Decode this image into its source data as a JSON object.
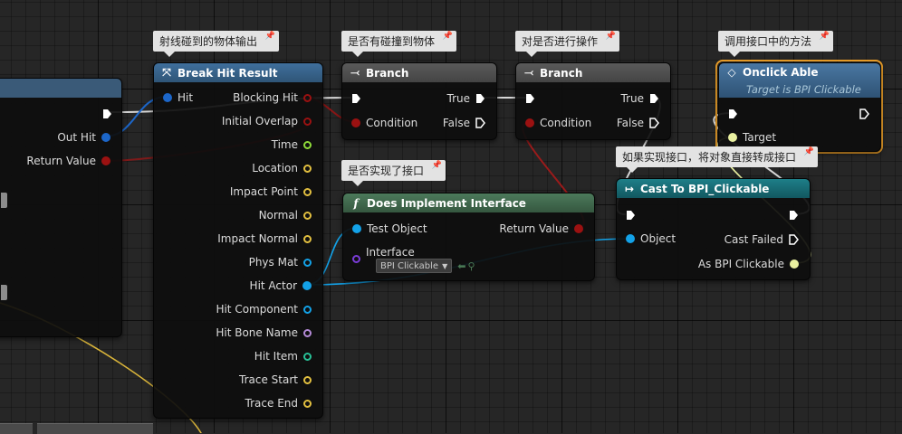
{
  "colors": {
    "exec": "#ffffff",
    "struct": "#1c66c9",
    "float_red": "#c42f2f",
    "bool_red": "#9b1111",
    "vector": "#e3c040",
    "object": "#13a2e8",
    "class": "#7a3cd8",
    "name": "#b58bd8",
    "int": "#28c197",
    "float": "#8fdc3a",
    "interface": "#e9f0a0",
    "hdr_function": "#3a6a95",
    "hdr_branch": "#505050",
    "hdr_cast": "#176b73",
    "hdr_pure": "#3f6b4d",
    "hdr_event": "#3d6388",
    "selection": "#f0a22a"
  },
  "left_node": {
    "pins": [
      {
        "label": "Out Hit",
        "type": "struct"
      },
      {
        "label": "Return Value",
        "type": "bool_red"
      }
    ]
  },
  "break_hit": {
    "title": "Break Hit Result",
    "icon": "break-struct-icon",
    "input": "Hit",
    "outputs": [
      {
        "label": "Blocking Hit",
        "type": "bool_red",
        "filled": false
      },
      {
        "label": "Initial Overlap",
        "type": "bool_red",
        "filled": false
      },
      {
        "label": "Time",
        "type": "float",
        "filled": false
      },
      {
        "label": "Location",
        "type": "vector",
        "filled": false
      },
      {
        "label": "Impact Point",
        "type": "vector",
        "filled": false
      },
      {
        "label": "Normal",
        "type": "vector",
        "filled": false
      },
      {
        "label": "Impact Normal",
        "type": "vector",
        "filled": false
      },
      {
        "label": "Phys Mat",
        "type": "object",
        "filled": false
      },
      {
        "label": "Hit Actor",
        "type": "object",
        "filled": true
      },
      {
        "label": "Hit Component",
        "type": "object",
        "filled": false
      },
      {
        "label": "Hit Bone Name",
        "type": "name",
        "filled": false
      },
      {
        "label": "Hit Item",
        "type": "int",
        "filled": false
      },
      {
        "label": "Trace Start",
        "type": "vector",
        "filled": false
      },
      {
        "label": "Trace End",
        "type": "vector",
        "filled": false
      }
    ]
  },
  "branch1": {
    "title": "Branch",
    "condition": "Condition",
    "true_label": "True",
    "false_label": "False"
  },
  "branch2": {
    "title": "Branch",
    "condition": "Condition",
    "true_label": "True",
    "false_label": "False"
  },
  "does_implement": {
    "title": "Does Implement Interface",
    "test_object": "Test Object",
    "return_value": "Return Value",
    "interface_label": "Interface",
    "interface_value": "BPI Clickable"
  },
  "cast": {
    "title": "Cast To BPI_Clickable",
    "object": "Object",
    "cast_failed": "Cast Failed",
    "as_label": "As BPI Clickable"
  },
  "onclick": {
    "title": "Onclick Able",
    "subtitle": "Target is BPI Clickable",
    "target": "Target"
  },
  "comments": {
    "c1": "射线碰到的物体输出",
    "c2": "是否有碰撞到物体",
    "c3": "对是否进行操作",
    "c4": "调用接口中的方法",
    "c5": "是否实现了接口",
    "c6": "如果实现接口，将对象直接转成接口"
  }
}
